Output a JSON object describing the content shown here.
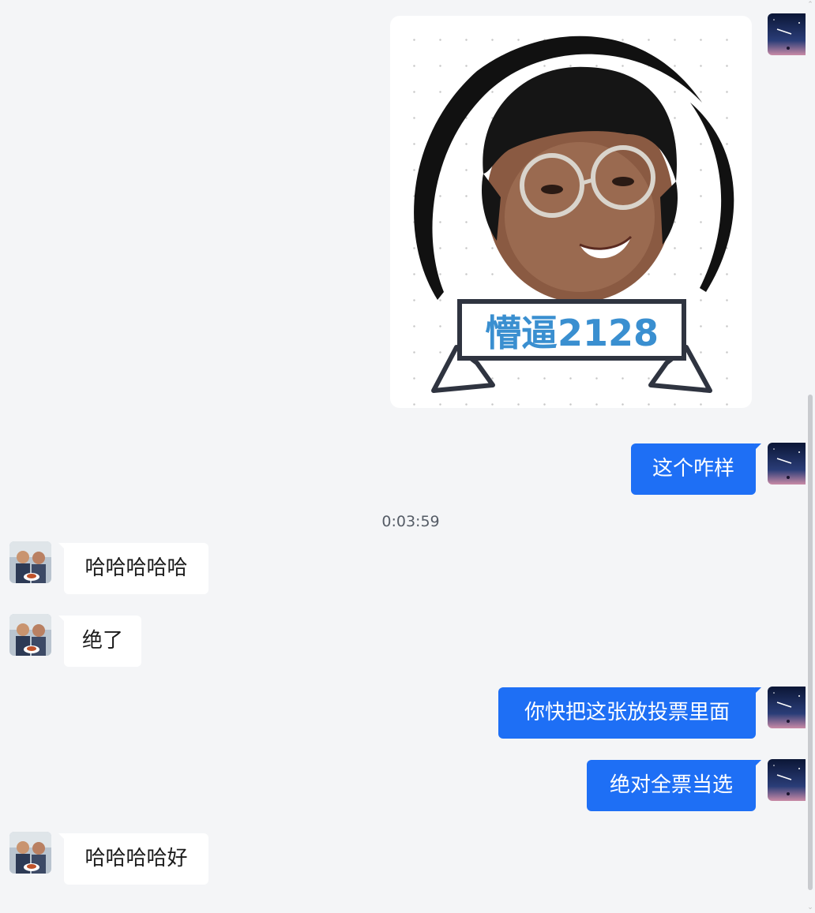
{
  "timestamp": "0:03:59",
  "sticker": {
    "banner_text": "懵逼2128"
  },
  "messages": {
    "m1": "这个咋样",
    "m2": "哈哈哈哈哈",
    "m3": "绝了",
    "m4": "你快把这张放投票里面",
    "m5": "绝对全票当选",
    "m6": "哈哈哈哈好"
  },
  "colors": {
    "outgoing_bubble": "#1e6ff5",
    "incoming_bubble": "#ffffff",
    "background": "#f4f5f7",
    "banner_text": "#3a8fd0"
  }
}
